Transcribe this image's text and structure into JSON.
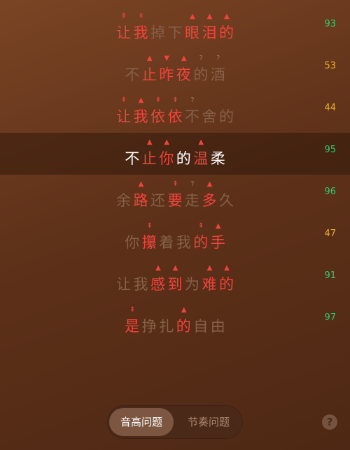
{
  "lyrics": [
    {
      "score": "93",
      "chars": [
        {
          "t": "让",
          "s": "hit",
          "m": "⇞"
        },
        {
          "t": "我",
          "s": "hit",
          "m": "⇞"
        },
        {
          "t": "掉",
          "s": "dim",
          "m": ""
        },
        {
          "t": "下",
          "s": "dim",
          "m": ""
        },
        {
          "t": "眼",
          "s": "hit",
          "m": "▲"
        },
        {
          "t": "泪",
          "s": "hit",
          "m": "▲"
        },
        {
          "t": "的",
          "s": "hit",
          "m": "▲"
        }
      ]
    },
    {
      "score": "53",
      "chars": [
        {
          "t": "不",
          "s": "dim",
          "m": ""
        },
        {
          "t": "止",
          "s": "hit",
          "m": "▲"
        },
        {
          "t": "昨",
          "s": "hit",
          "m": "▼"
        },
        {
          "t": "夜",
          "s": "hit",
          "m": "▲"
        },
        {
          "t": "的",
          "s": "dim",
          "m": "?"
        },
        {
          "t": "酒",
          "s": "dim",
          "m": "?"
        }
      ]
    },
    {
      "score": "44",
      "chars": [
        {
          "t": "让",
          "s": "hit",
          "m": "⇞"
        },
        {
          "t": "我",
          "s": "hit",
          "m": "▲"
        },
        {
          "t": "依",
          "s": "hit",
          "m": "⇞"
        },
        {
          "t": "依",
          "s": "hit",
          "m": "⇞"
        },
        {
          "t": "不",
          "s": "dim",
          "m": "?"
        },
        {
          "t": "舍",
          "s": "dim",
          "m": ""
        },
        {
          "t": "的",
          "s": "dim",
          "m": ""
        }
      ]
    },
    {
      "score": "95",
      "current": true,
      "chars": [
        {
          "t": "不",
          "s": "cur",
          "m": ""
        },
        {
          "t": "止",
          "s": "hit",
          "m": "▲"
        },
        {
          "t": "你",
          "s": "hit",
          "m": "▲"
        },
        {
          "t": "的",
          "s": "cur",
          "m": ""
        },
        {
          "t": "温",
          "s": "hit",
          "m": "▲"
        },
        {
          "t": "柔",
          "s": "cur",
          "m": ""
        }
      ]
    },
    {
      "score": "96",
      "chars": [
        {
          "t": "余",
          "s": "dim",
          "m": ""
        },
        {
          "t": "路",
          "s": "hit",
          "m": "▲"
        },
        {
          "t": "还",
          "s": "dim",
          "m": ""
        },
        {
          "t": "要",
          "s": "hit",
          "m": "⇞"
        },
        {
          "t": "走",
          "s": "dim",
          "m": "?"
        },
        {
          "t": "多",
          "s": "hit",
          "m": "▲"
        },
        {
          "t": "久",
          "s": "dim",
          "m": ""
        }
      ]
    },
    {
      "score": "47",
      "chars": [
        {
          "t": "你",
          "s": "dim",
          "m": ""
        },
        {
          "t": "攥",
          "s": "hit",
          "m": "⇞"
        },
        {
          "t": "着",
          "s": "dim",
          "m": ""
        },
        {
          "t": "我",
          "s": "dim",
          "m": ""
        },
        {
          "t": "的",
          "s": "hit",
          "m": "⇞"
        },
        {
          "t": "手",
          "s": "hit",
          "m": "▲"
        }
      ]
    },
    {
      "score": "91",
      "chars": [
        {
          "t": "让",
          "s": "dim",
          "m": ""
        },
        {
          "t": "我",
          "s": "dim",
          "m": ""
        },
        {
          "t": "感",
          "s": "hit",
          "m": "▲"
        },
        {
          "t": "到",
          "s": "hit",
          "m": "▲"
        },
        {
          "t": "为",
          "s": "dim",
          "m": ""
        },
        {
          "t": "难",
          "s": "hit",
          "m": "▲"
        },
        {
          "t": "的",
          "s": "hit",
          "m": "▲"
        }
      ]
    },
    {
      "score": "97",
      "chars": [
        {
          "t": "是",
          "s": "hit",
          "m": "⇞"
        },
        {
          "t": "挣",
          "s": "dim",
          "m": ""
        },
        {
          "t": "扎",
          "s": "dim",
          "m": ""
        },
        {
          "t": "的",
          "s": "hit",
          "m": "▲"
        },
        {
          "t": "自",
          "s": "dim",
          "m": ""
        },
        {
          "t": "由",
          "s": "dim",
          "m": ""
        }
      ]
    }
  ],
  "colors": {
    "hit": "#f0443d",
    "dim": "#866048",
    "current": "#ffffff",
    "score_good": "#2ecc71",
    "score_mid": "#e6b030"
  },
  "tabs": {
    "pitch_label": "音高问题",
    "rhythm_label": "节奏问题",
    "active": "pitch"
  },
  "help": {
    "icon": "question-mark-icon",
    "glyph": "?"
  }
}
